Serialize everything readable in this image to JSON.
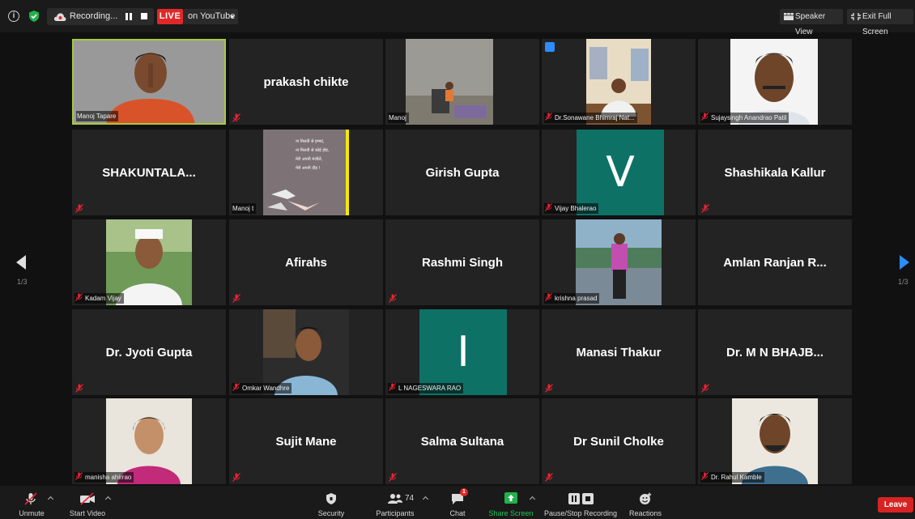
{
  "topbar": {
    "recording_label": "Recording...",
    "live_label": "LIVE",
    "live_target": "on YouTube",
    "speaker_view_label": "Speaker View",
    "exit_fullscreen_label": "Exit Full Screen"
  },
  "navigation": {
    "left_page": "1/3",
    "right_page": "1/3"
  },
  "tiles": [
    {
      "center": "",
      "label": "Manoj Tapare"
    },
    {
      "center": "prakash chikte",
      "label": ""
    },
    {
      "center": "",
      "label": "Manoj"
    },
    {
      "center": "",
      "label": "Dr.Sonawane Bhimraj Nat..."
    },
    {
      "center": "",
      "label": "Sujaysingh Anandrao Patil"
    },
    {
      "center": "SHAKUNTALA...",
      "label": ""
    },
    {
      "center": "",
      "label": "Manoj t",
      "poem": [
        "ना मिलती से हम्मदं,",
        "ना मिलती से कोई होड़,",
        "मेरी अपनी मंजीलें,",
        "मेरी अपनी दौड़ !"
      ]
    },
    {
      "center": "Girish Gupta",
      "label": ""
    },
    {
      "center": "",
      "label": "Vijay Bhalerao",
      "avatar": "V"
    },
    {
      "center": "Shashikala Kallur",
      "label": ""
    },
    {
      "center": "",
      "label": "Kadam Vijay"
    },
    {
      "center": "Afirahs",
      "label": ""
    },
    {
      "center": "Rashmi Singh",
      "label": ""
    },
    {
      "center": "",
      "label": "krishna prasad"
    },
    {
      "center": "Amlan Ranjan R...",
      "label": ""
    },
    {
      "center": "Dr. Jyoti Gupta",
      "label": ""
    },
    {
      "center": "",
      "label": "Omkar Wandhre"
    },
    {
      "center": "",
      "label": "L NAGESWARA RAO",
      "avatar": "I"
    },
    {
      "center": "Manasi Thakur",
      "label": ""
    },
    {
      "center": "Dr. M N BHAJB...",
      "label": ""
    },
    {
      "center": "",
      "label": "manisha ahirrao"
    },
    {
      "center": "Sujit Mane",
      "label": ""
    },
    {
      "center": "Salma Sultana",
      "label": ""
    },
    {
      "center": "Dr Sunil Cholke",
      "label": ""
    },
    {
      "center": "",
      "label": "Dr. Rahul Kamble"
    }
  ],
  "toolbar": {
    "unmute": "Unmute",
    "start_video": "Start Video",
    "security": "Security",
    "participants": "Participants",
    "participants_count": "74",
    "chat": "Chat",
    "chat_badge": "1",
    "share_screen": "Share Screen",
    "pause_recording": "Pause/Stop Recording",
    "reactions": "Reactions",
    "leave": "Leave"
  },
  "colors": {
    "active_speaker": "#a8c93e",
    "accent_blue": "#2d8cff",
    "live_red": "#e02828",
    "share_green": "#22b14c",
    "avatar_teal": "#0e7166"
  }
}
